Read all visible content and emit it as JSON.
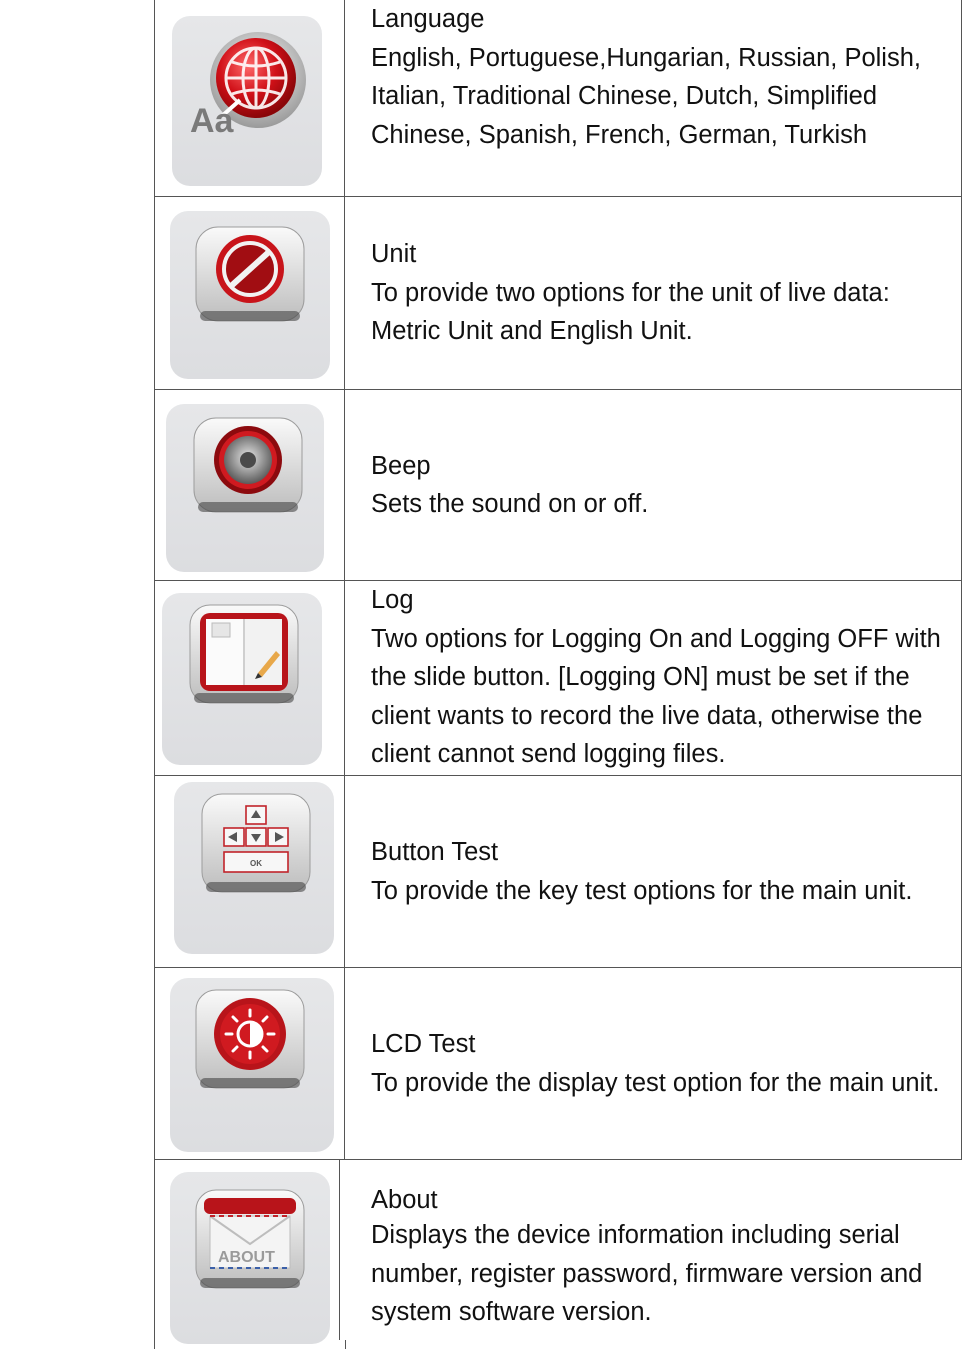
{
  "settings": [
    {
      "title": "Language",
      "description": "English, Portuguese,Hungarian, Russian, Polish,    Italian, Traditional Chinese, Dutch, Simplified Chinese, Spanish, French, German, Turkish",
      "icon": "language-icon"
    },
    {
      "title": "Unit",
      "description": "To provide two options for the unit of live data: Metric Unit and English Unit.",
      "icon": "unit-icon"
    },
    {
      "title": "Beep",
      "description": "Sets the sound on or off.",
      "icon": "speaker-icon"
    },
    {
      "title": "Log",
      "description": "Two options for Logging On and Logging OFF with the slide button. [Logging ON] must be set if the client wants to record the live data, otherwise the client cannot send logging files.",
      "icon": "log-book-icon"
    },
    {
      "title": "Button Test",
      "description": "To provide the key test options for the main unit.",
      "icon": "keypad-icon"
    },
    {
      "title": "LCD Test",
      "description": "To provide the display test option for the main unit.",
      "icon": "brightness-icon"
    },
    {
      "title": "About",
      "description": "Displays the device information including serial number, register password, firmware version and system software version.",
      "icon": "about-envelope-icon"
    }
  ],
  "icon_text": {
    "language_glyph": "Aa",
    "keypad_ok": "OK",
    "about_label": "ABOUT"
  },
  "colors": {
    "accent_red": "#c8141a",
    "border": "#555555",
    "icon_bg": "#e0e1e3"
  }
}
